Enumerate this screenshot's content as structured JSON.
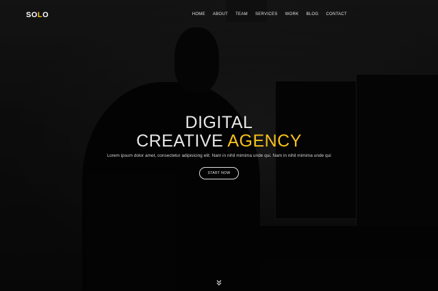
{
  "brand": {
    "prefix": "SO",
    "accent": "L",
    "suffix": "O"
  },
  "nav": {
    "items": [
      {
        "label": "HOME"
      },
      {
        "label": "ABOUT"
      },
      {
        "label": "TEAM"
      },
      {
        "label": "SERVICES"
      },
      {
        "label": "WORK"
      },
      {
        "label": "BLOG"
      },
      {
        "label": "CONTACT"
      }
    ]
  },
  "hero": {
    "line1": "DIGITAL",
    "line2_white": "CREATIVE",
    "line2_accent": "AGENCY",
    "subtitle": "Lorem ipsum dolor amet, consectetur adipisicing elit. Nam in nihil mimima unde qui. Nam in nihil mimima unde qui",
    "cta": "START NOW"
  },
  "icons": {
    "scroll": "double-chevron-down-icon"
  },
  "colors": {
    "accent": "#f7c21b",
    "background": "#0b0b0b",
    "text": "#e8e8e8"
  }
}
